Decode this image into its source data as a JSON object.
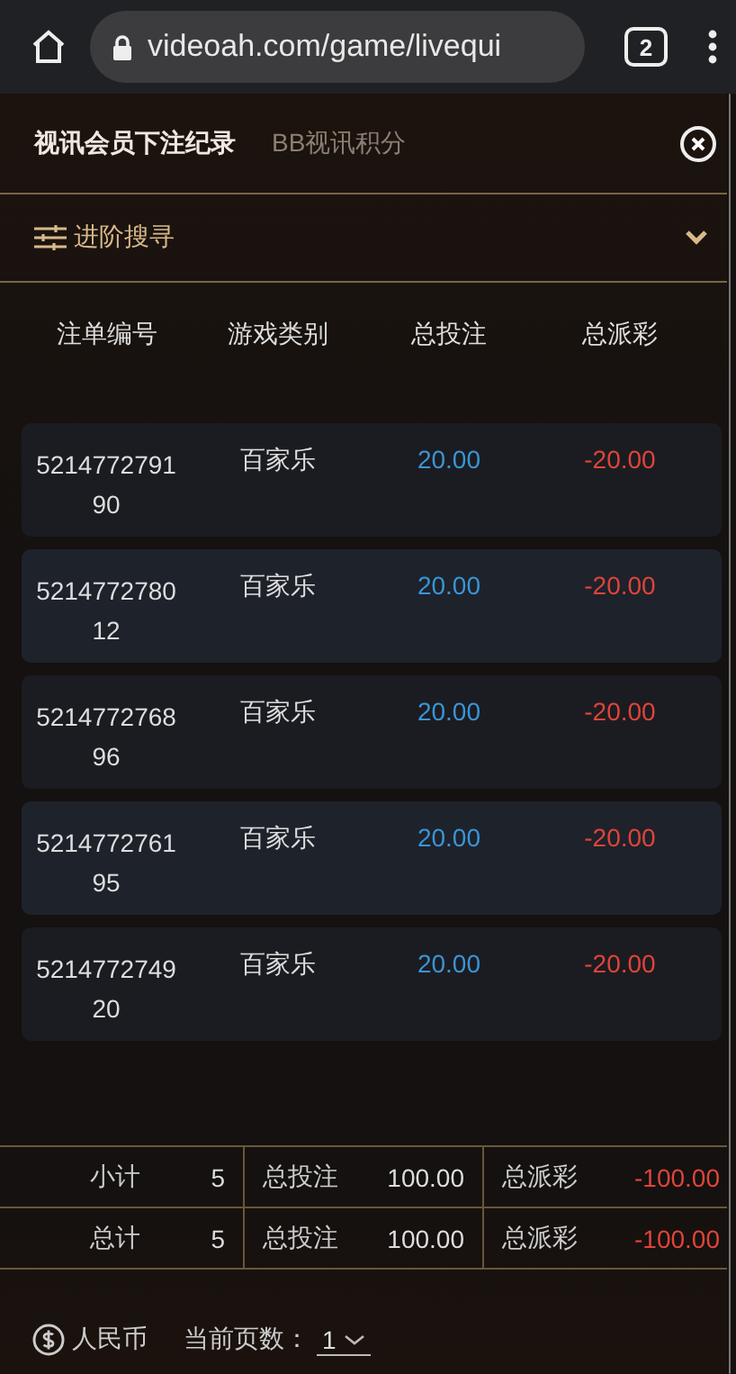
{
  "browser": {
    "url": "videoah.com/game/livequi",
    "tab_count": "2"
  },
  "tabs": [
    {
      "label": "视讯会员下注纪录",
      "selected": true
    },
    {
      "label": "BB视讯积分",
      "selected": false
    }
  ],
  "advanced_search": {
    "label": "进阶搜寻",
    "expanded": false
  },
  "table": {
    "columns": [
      "注单编号",
      "游戏类别",
      "总投注",
      "总派彩"
    ],
    "rows": [
      {
        "order_no": "521477279190",
        "game": "百家乐",
        "bet": "20.00",
        "payout": "-20.00"
      },
      {
        "order_no": "521477278012",
        "game": "百家乐",
        "bet": "20.00",
        "payout": "-20.00"
      },
      {
        "order_no": "521477276896",
        "game": "百家乐",
        "bet": "20.00",
        "payout": "-20.00"
      },
      {
        "order_no": "521477276195",
        "game": "百家乐",
        "bet": "20.00",
        "payout": "-20.00"
      },
      {
        "order_no": "521477274920",
        "game": "百家乐",
        "bet": "20.00",
        "payout": "-20.00"
      }
    ]
  },
  "summary": [
    {
      "label": "小计",
      "count": "5",
      "bet_label": "总投注",
      "bet": "100.00",
      "payout_label": "总派彩",
      "payout": "-100.00"
    },
    {
      "label": "总计",
      "count": "5",
      "bet_label": "总投注",
      "bet": "100.00",
      "payout_label": "总派彩",
      "payout": "-100.00"
    }
  ],
  "footer": {
    "currency": "人民币",
    "page_label": "当前页数：",
    "page": "1"
  }
}
